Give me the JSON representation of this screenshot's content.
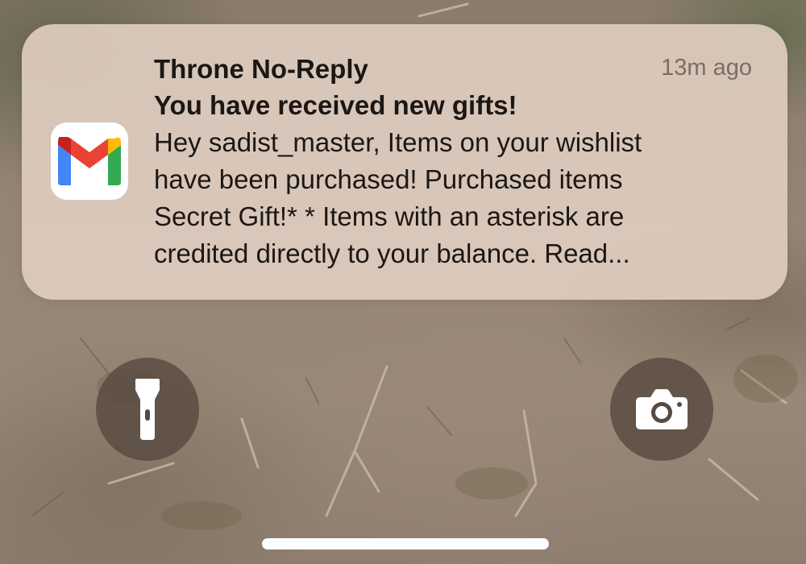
{
  "notification": {
    "app_icon": "gmail-icon",
    "sender": "Throne No-Reply",
    "time": "13m ago",
    "subject": "You have received new gifts!",
    "body_lines": [
      "Hey sadist_master, Items on your wishlist",
      "have been purchased! Purchased items",
      "Secret Gift!* * Items with an asterisk are",
      "credited directly to your balance. Read..."
    ]
  },
  "lock_screen": {
    "left_button_icon": "flashlight-icon",
    "right_button_icon": "camera-icon"
  },
  "colors": {
    "notification_bg": "#decbbe",
    "text_primary": "#1c1714",
    "text_secondary": "#7c6c62",
    "button_bg": "#584a40",
    "gmail_red": "#ea4335",
    "gmail_blue": "#4285f4",
    "gmail_green": "#34a853",
    "gmail_yellow": "#fbbc04"
  }
}
